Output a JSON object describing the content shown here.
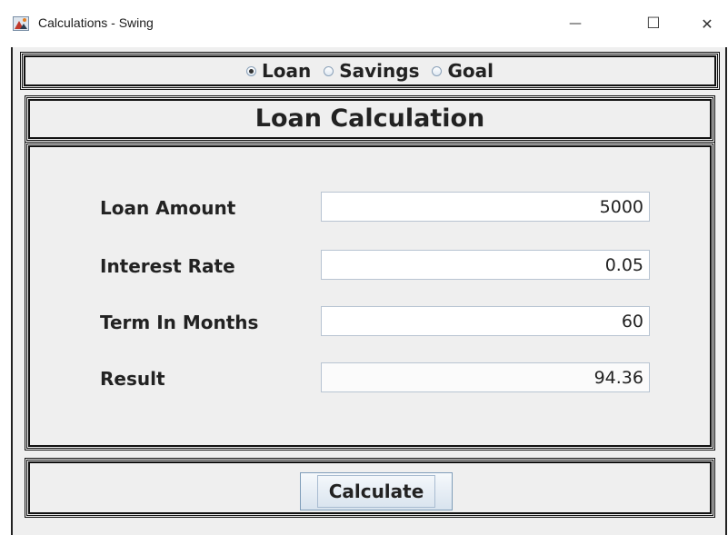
{
  "window": {
    "title": "Calculations - Swing",
    "controls": {
      "minimize": "—",
      "maximize": "☐",
      "close": "✕"
    }
  },
  "modes": {
    "options": [
      {
        "label": "Loan",
        "selected": true
      },
      {
        "label": "Savings",
        "selected": false
      },
      {
        "label": "Goal",
        "selected": false
      }
    ]
  },
  "section": {
    "title": "Loan Calculation"
  },
  "form": {
    "fields": [
      {
        "label": "Loan Amount",
        "value": "5000"
      },
      {
        "label": "Interest Rate",
        "value": "0.05"
      },
      {
        "label": "Term In Months",
        "value": "60"
      },
      {
        "label": "Result",
        "value": "94.36"
      }
    ]
  },
  "actions": {
    "calculate_label": "Calculate"
  },
  "colors": {
    "frame_bg": "#efefef",
    "border": "#111111",
    "button_border": "#7f9db9"
  }
}
